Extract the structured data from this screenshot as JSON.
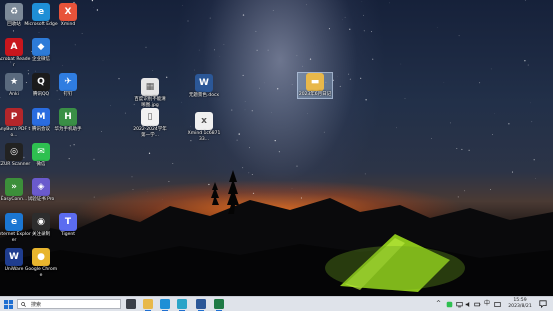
{
  "desktop_icons": [
    {
      "name": "recycle-bin-icon",
      "label": "回收站",
      "color": "#7d8a99",
      "glyph": "♻"
    },
    {
      "name": "edge-icon",
      "label": "Microsoft Edge",
      "color": "#1f8fd6",
      "glyph": "e"
    },
    {
      "name": "xmind-icon",
      "label": "Xmind",
      "color": "#e8533a",
      "glyph": "X"
    },
    {
      "name": "acrobat-icon",
      "label": "Acrobat Reader",
      "color": "#c8161d",
      "glyph": "A"
    },
    {
      "name": "enterprise-wechat-icon",
      "label": "企业微信",
      "color": "#2d7bd8",
      "glyph": "◆"
    },
    {
      "name": "anki-icon",
      "label": "Anki",
      "color": "#5a6a7e",
      "glyph": "★"
    },
    {
      "name": "qq-icon",
      "label": "腾讯QQ",
      "color": "#1b1b1b",
      "glyph": "Q"
    },
    {
      "name": "feishu-icon",
      "label": "钉钉",
      "color": "#2f7de1",
      "glyph": "✈"
    },
    {
      "name": "jpg-file-icon",
      "label": "百度识别不能清晰图.jpg",
      "color": "#e6e6e6",
      "glyph": "▦"
    },
    {
      "name": "docx-file-icon",
      "label": "无题景色.docx",
      "color": "#2b5797",
      "glyph": "W"
    },
    {
      "name": "folder-icon",
      "label": "2023年6月日记",
      "color": "#e8b84a",
      "glyph": "▬"
    },
    {
      "name": "anyburn-icon",
      "label": "AnyBurn PDF to...",
      "color": "#b3262a",
      "glyph": "P"
    },
    {
      "name": "tencent-meeting-icon",
      "label": "腾讯会议",
      "color": "#2a6ce0",
      "glyph": "M"
    },
    {
      "name": "huawei-icon",
      "label": "华为手机助手",
      "color": "#3a8f46",
      "glyph": "H"
    },
    {
      "name": "doc-file-icon",
      "label": "2022-2024学年第一学...",
      "color": "#f2f2f2",
      "glyph": "▯"
    },
    {
      "name": "xmind-file-icon",
      "label": "Xmind 1c687133...",
      "color": "#f0f0f0",
      "glyph": "x"
    },
    {
      "name": "czur-icon",
      "label": "CZUR Scanner",
      "color": "#222222",
      "glyph": "◎"
    },
    {
      "name": "wechat-icon",
      "label": "微信",
      "color": "#2ec050",
      "glyph": "✉"
    },
    {
      "name": "easyconnect-icon",
      "label": "EasyConn...",
      "color": "#3c8f3a",
      "glyph": "»"
    },
    {
      "name": "trial-icon",
      "label": "试验证书 Pro",
      "color": "#6a5acd",
      "glyph": "◈"
    },
    {
      "name": "ie-icon",
      "label": "Internet Explorer",
      "color": "#1b76d2",
      "glyph": "e"
    },
    {
      "name": "obs-icon",
      "label": "关注录制",
      "color": "#2d2d2d",
      "glyph": "◉"
    },
    {
      "name": "tiger-icon",
      "label": "Tigent",
      "color": "#5b6cf0",
      "glyph": "T"
    },
    {
      "name": "uniware-icon",
      "label": "UniWare",
      "color": "#1f3d8f",
      "glyph": "W"
    },
    {
      "name": "chrome-icon",
      "label": "Google Chrome",
      "color": "#e8b52e",
      "glyph": "●"
    }
  ],
  "taskbar": {
    "search_placeholder": "搜索",
    "tray_chevron": "^",
    "tray_lang": "中",
    "clock_time": "15:59",
    "clock_date": "2023/8/21"
  },
  "taskbar_apps": [
    {
      "name": "task-view-icon",
      "color": "#3a3f48"
    },
    {
      "name": "file-explorer-icon",
      "color": "#e8b84a"
    },
    {
      "name": "edge-taskbar-icon",
      "color": "#1f8fd6"
    },
    {
      "name": "edge-dev-taskbar-icon",
      "color": "#2aa4c8"
    },
    {
      "name": "word-taskbar-icon",
      "color": "#2b5797"
    },
    {
      "name": "excel-taskbar-icon",
      "color": "#1f7a45"
    }
  ]
}
